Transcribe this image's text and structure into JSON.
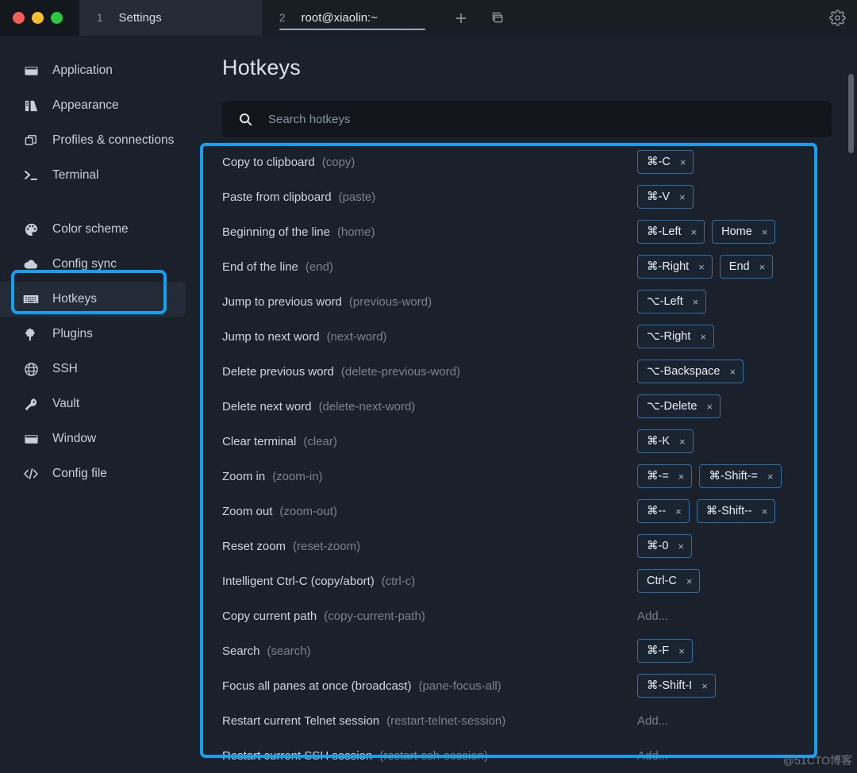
{
  "window": {
    "traffic_lights": [
      "close",
      "minimize",
      "maximize"
    ],
    "tabs": [
      {
        "index": "1",
        "title": "Settings",
        "active": false
      },
      {
        "index": "2",
        "title": "root@xiaolin:~",
        "active": true
      }
    ],
    "new_tab_label": "+",
    "split_icon": "new-window-icon",
    "gear_icon": "gear-icon"
  },
  "sidebar": {
    "items": [
      {
        "label": "Application",
        "icon": "application-icon"
      },
      {
        "label": "Appearance",
        "icon": "appearance-icon"
      },
      {
        "label": "Profiles & connections",
        "icon": "profiles-icon"
      },
      {
        "label": "Terminal",
        "icon": "terminal-icon"
      },
      {
        "label": "Color scheme",
        "icon": "palette-icon"
      },
      {
        "label": "Config sync",
        "icon": "cloud-icon"
      },
      {
        "label": "Hotkeys",
        "icon": "keyboard-icon"
      },
      {
        "label": "Plugins",
        "icon": "puzzle-icon"
      },
      {
        "label": "SSH",
        "icon": "globe-icon"
      },
      {
        "label": "Vault",
        "icon": "key-icon"
      },
      {
        "label": "Window",
        "icon": "window-icon"
      },
      {
        "label": "Config file",
        "icon": "code-icon"
      }
    ],
    "active_label": "Hotkeys"
  },
  "main": {
    "title": "Hotkeys",
    "search": {
      "placeholder": "Search hotkeys",
      "value": "",
      "icon": "search-icon"
    },
    "add_label": "Add...",
    "hotkeys": [
      {
        "label": "Copy to clipboard",
        "id": "(copy)",
        "chips": [
          "⌘-C"
        ]
      },
      {
        "label": "Paste from clipboard",
        "id": "(paste)",
        "chips": [
          "⌘-V"
        ]
      },
      {
        "label": "Beginning of the line",
        "id": "(home)",
        "chips": [
          "⌘-Left",
          "Home"
        ]
      },
      {
        "label": "End of the line",
        "id": "(end)",
        "chips": [
          "⌘-Right",
          "End"
        ]
      },
      {
        "label": "Jump to previous word",
        "id": "(previous-word)",
        "chips": [
          "⌥-Left"
        ]
      },
      {
        "label": "Jump to next word",
        "id": "(next-word)",
        "chips": [
          "⌥-Right"
        ]
      },
      {
        "label": "Delete previous word",
        "id": "(delete-previous-word)",
        "chips": [
          "⌥-Backspace"
        ]
      },
      {
        "label": "Delete next word",
        "id": "(delete-next-word)",
        "chips": [
          "⌥-Delete"
        ]
      },
      {
        "label": "Clear terminal",
        "id": "(clear)",
        "chips": [
          "⌘-K"
        ]
      },
      {
        "label": "Zoom in",
        "id": "(zoom-in)",
        "chips": [
          "⌘-=",
          "⌘-Shift-="
        ]
      },
      {
        "label": "Zoom out",
        "id": "(zoom-out)",
        "chips": [
          "⌘--",
          "⌘-Shift--"
        ]
      },
      {
        "label": "Reset zoom",
        "id": "(reset-zoom)",
        "chips": [
          "⌘-0"
        ]
      },
      {
        "label": "Intelligent Ctrl-C (copy/abort)",
        "id": "(ctrl-c)",
        "chips": [
          "Ctrl-C"
        ]
      },
      {
        "label": "Copy current path",
        "id": "(copy-current-path)",
        "chips": []
      },
      {
        "label": "Search",
        "id": "(search)",
        "chips": [
          "⌘-F"
        ]
      },
      {
        "label": "Focus all panes at once (broadcast)",
        "id": "(pane-focus-all)",
        "chips": [
          "⌘-Shift-I"
        ]
      },
      {
        "label": "Restart current Telnet session",
        "id": "(restart-telnet-session)",
        "chips": []
      },
      {
        "label": "Restart current SSH session",
        "id": "(restart-ssh-session)",
        "chips": []
      }
    ]
  },
  "annotations": {
    "sidebar_highlight": "Hotkeys",
    "list_highlight": "hotkey-list",
    "color": "#18a0f0"
  },
  "watermark": {
    "text": "@51CTO博客"
  }
}
